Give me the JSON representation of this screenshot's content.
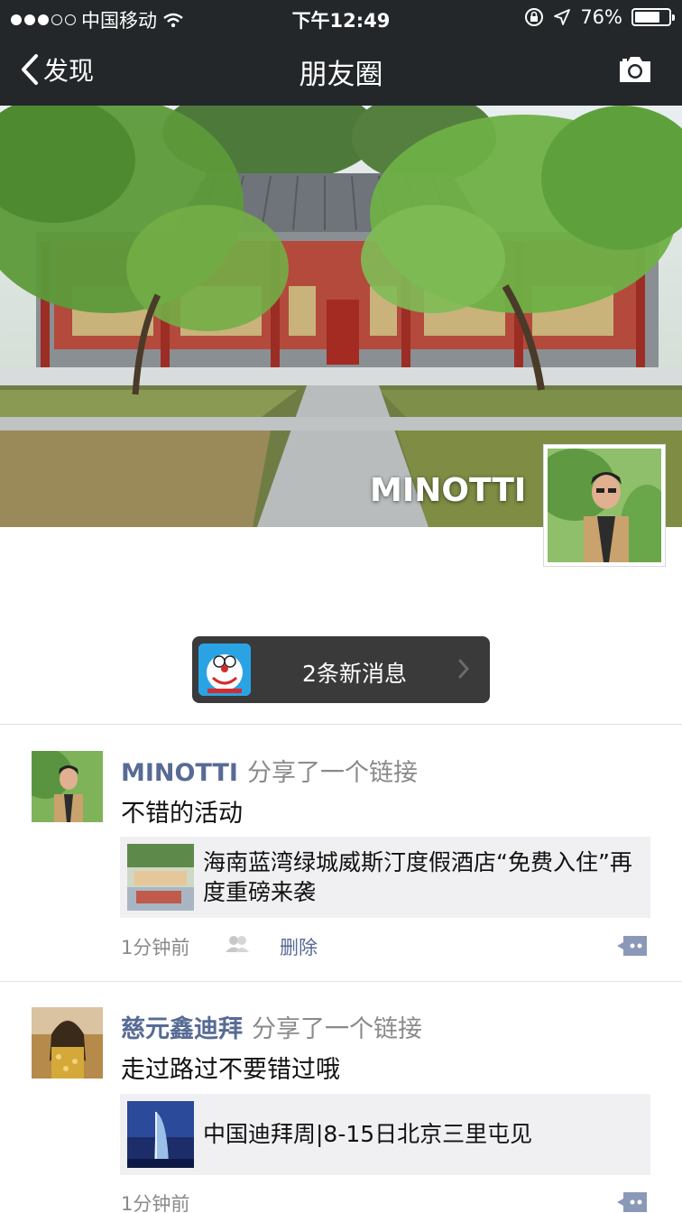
{
  "status_bar": {
    "carrier": "中国移动",
    "time": "下午12:49",
    "battery": "76%",
    "battery_level": 0.76
  },
  "nav": {
    "back_label": "发现",
    "title": "朋友圈",
    "camera_icon": "camera-icon"
  },
  "cover": {
    "name": "MINOTTI"
  },
  "new_messages": {
    "label": "2条新消息"
  },
  "posts": [
    {
      "author": "MINOTTI",
      "action": "分享了一个链接",
      "text": "不错的活动",
      "link_title": "海南蓝湾绿城威斯汀度假酒店“免费入住”再度重磅来袭",
      "time": "1分钟前",
      "delete_label": "删除"
    },
    {
      "author": "慈元鑫迪拜",
      "action": "分享了一个链接",
      "text": "走过路过不要错过哦",
      "link_title": "中国迪拜周|8-15日北京三里屯见",
      "time": "1分钟前"
    }
  ],
  "colors": {
    "nav_bg": "#23272a",
    "link_name": "#576b95",
    "link_card_bg": "#f0f0f2"
  }
}
